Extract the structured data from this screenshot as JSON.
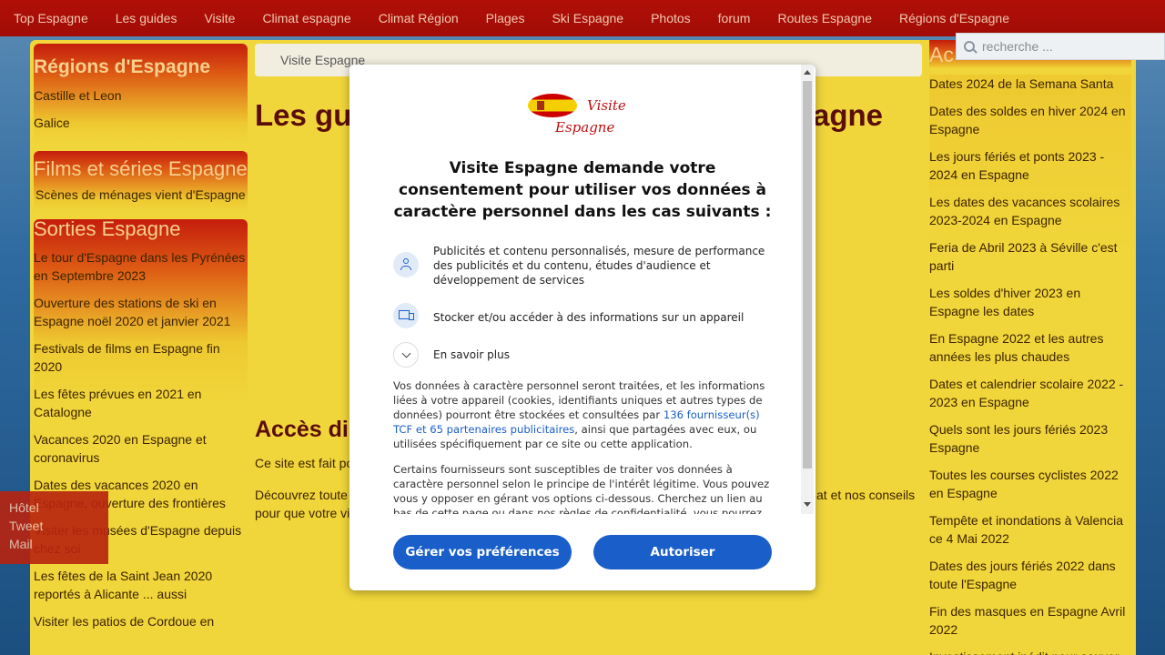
{
  "topnav": [
    "Top Espagne",
    "Les guides",
    "Visite",
    "Climat espagne",
    "Climat Région",
    "Plages",
    "Ski Espagne",
    "Photos",
    "forum",
    "Routes Espagne",
    "Régions d'Espagne"
  ],
  "search": {
    "placeholder": "recherche ..."
  },
  "breadcrumb": "Visite Espagne",
  "main": {
    "title_left": "Les gui",
    "title_right": "agne",
    "acces_heading": "Accès dir",
    "para1": "Ce site est fait pour",
    "para2_left": "Découvrez toute",
    "para2_right": "at et nos conseils",
    "para2_line2": "pour que votre vi"
  },
  "left": {
    "regions": {
      "title": "Régions d'Espagne",
      "items": [
        "Castille et Leon",
        "Galice"
      ]
    },
    "films": {
      "title": "Films et séries Espagne",
      "items": [
        "Scènes de ménages vient d'Espagne"
      ]
    },
    "sorties": {
      "title": "Sorties Espagne",
      "items": [
        "Le tour d'Espagne dans les Pyrénées en Septembre 2023",
        "Ouverture des stations de ski en Espagne noël 2020 et janvier 2021",
        "Festivals de films en Espagne fin 2020",
        "Les fêtes prévues en 2021 en Catalogne",
        "Vacances 2020 en Espagne et coronavirus",
        "Dates des vacances 2020 en Espagne, ouverture des frontières",
        "Visiter les musées d'Espagne depuis chez soi",
        "Les fêtes de la Saint Jean 2020 reportés à Alicante ... aussi",
        "Visiter les patios de Cordoue en"
      ]
    }
  },
  "right": {
    "title": "Ac",
    "items": [
      "Dates 2024 de la Semana Santa",
      "Dates des soldes en hiver 2024 en Espagne",
      "Les jours fériés et ponts 2023 - 2024 en Espagne",
      "Les dates des vacances scolaires 2023-2024 en Espagne",
      "Feria de Abril 2023 à Séville c'est parti",
      "Les soldes d'hiver 2023 en Espagne les dates",
      "En Espagne 2022 et les autres années les plus chaudes",
      "Dates et calendrier scolaire 2022 - 2023 en Espagne",
      "Quels sont les jours fériés 2023 Espagne",
      "Toutes les courses cyclistes 2022 en Espagne",
      "Tempête et inondations à Valencia ce 4 Mai 2022",
      "Dates des jours fériés 2022 dans toute l'Espagne",
      "Fin des masques en Espagne Avril 2022",
      "Investissement inédit pour sauver"
    ]
  },
  "social": [
    "Hôtel",
    "Tweet",
    "Mail"
  ],
  "modal": {
    "logo_line1": "Visite",
    "logo_line2": "Espagne",
    "title": "Visite Espagne demande votre consentement pour utiliser vos données à caractère personnel dans les cas suivants :",
    "purpose1": "Publicités et contenu personnalisés, mesure de performance des publicités et du contenu, études d'audience et développement de services",
    "purpose2": "Stocker et/ou accéder à des informations sur un appareil",
    "learn_more": "En savoir plus",
    "para1_a": "Vos données à caractère personnel seront traitées, et les informations liées à votre appareil (cookies, identifiants uniques et autres types de données) pourront être stockées et consultées par ",
    "para1_link": "136 fournisseur(s) TCF et 65 partenaires publicitaires",
    "para1_b": ", ainsi que partagées avec eux, ou utilisées spécifiquement par ce site ou cette application.",
    "para2": "Certains fournisseurs sont susceptibles de traiter vos données à caractère personnel selon le principe de l'intérêt légitime. Vous pouvez vous y opposer en gérant vos options ci-dessous. Cherchez un lien au bas de cette page ou dans nos règles de confidentialité, vous pourrez y retirer",
    "btn_manage": "Gérer vos préférences",
    "btn_allow": "Autoriser"
  }
}
